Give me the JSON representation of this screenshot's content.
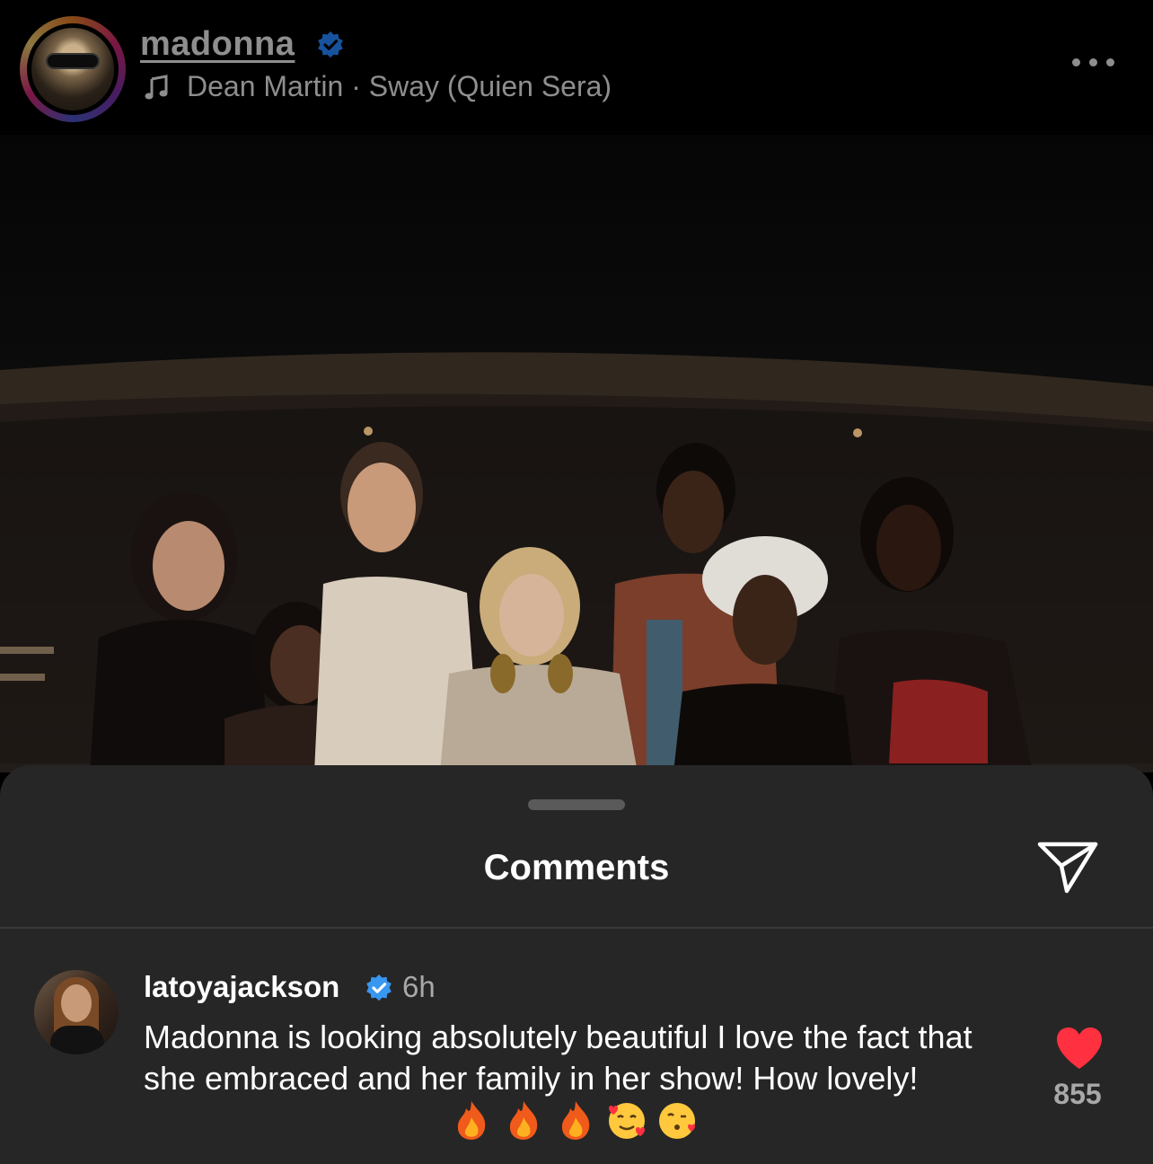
{
  "post": {
    "username": "madonna",
    "verified": true,
    "audio": "Dean Martin · Sway (Quien Sera)",
    "icons": {
      "music": "music-note-icon",
      "more": "more-options-icon",
      "verified": "verified-badge-icon"
    }
  },
  "comments_sheet": {
    "title": "Comments",
    "share_icon": "send-icon",
    "comments": [
      {
        "username": "latoyajackson",
        "verified": true,
        "time": "6h",
        "text": "Madonna is looking absolutely beautiful I love the fact that she embraced and her family in her show! How lovely!",
        "emojis": [
          "fire-emoji",
          "fire-emoji",
          "fire-emoji",
          "smiling-face-with-hearts-emoji",
          "face-blowing-kiss-emoji"
        ],
        "liked": true,
        "like_count": "855"
      }
    ]
  },
  "colors": {
    "background": "#000000",
    "sheet": "#262626",
    "secondary_text": "#8e8e8e",
    "verified_blue": "#3897f0",
    "like_red": "#ff3040"
  }
}
